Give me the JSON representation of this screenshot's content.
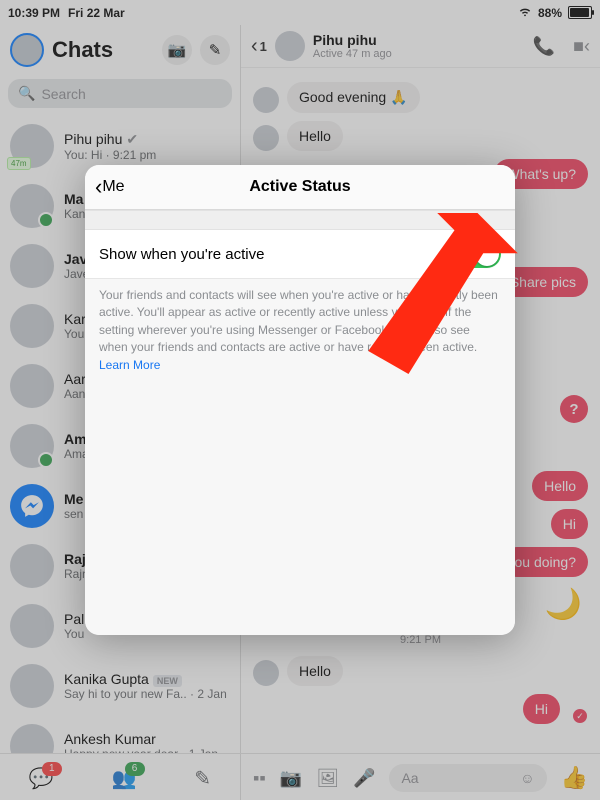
{
  "statusbar": {
    "time": "10:39 PM",
    "date": "Fri 22 Mar",
    "battery_pct": "88%"
  },
  "sidebar": {
    "title": "Chats",
    "search_placeholder": "Search",
    "items": [
      {
        "name": "Pihu pihu",
        "preview": "You: Hi · 9:21 pm",
        "badge": "47m",
        "verified": true
      },
      {
        "name": "Ma",
        "preview": "Kan",
        "online": true
      },
      {
        "name": "Jav",
        "preview": "Jave"
      },
      {
        "name": "Kar",
        "preview": "You"
      },
      {
        "name": "Aar",
        "preview": "Aan"
      },
      {
        "name": "Am",
        "preview": "Ama",
        "online": true
      },
      {
        "name": "Me",
        "preview": "sen",
        "messenger": true
      },
      {
        "name": "Raj",
        "preview": "Rajn"
      },
      {
        "name": "Pal",
        "preview": "You"
      },
      {
        "name": "Kanika Gupta",
        "preview": "Say hi to your new Fa.. · 2 Jan",
        "new": true
      },
      {
        "name": "Ankesh Kumar",
        "preview": "Happy new year dear · 1 Jan"
      }
    ]
  },
  "conversation": {
    "back_unread": "1",
    "name": "Pihu pihu",
    "subtitle": "Active 47 m ago",
    "messages": {
      "in1": "Good evening 🙏",
      "in2": "Hello",
      "out1": "What's up?",
      "out2": "Share pics",
      "q": "?",
      "out3": "Hello",
      "out4": "Hi",
      "out5": "ou doing?",
      "timestamp": "9:21 PM",
      "in3": "Hello",
      "out6": "Hi"
    },
    "compose_placeholder": "Aa"
  },
  "bottom_nav": {
    "chat_badge": "1",
    "people_badge": "6"
  },
  "modal": {
    "back_label": "Me",
    "title": "Active Status",
    "toggle_label": "Show when you're active",
    "description": "Your friends and contacts will see when you're active or have recently been active. You'll appear as active or recently active unless you turn off the setting wherever you're using Messenger or Facebook. You'll also see when your friends and contacts are active or have recently been active. ",
    "learn_more": "Learn More"
  }
}
